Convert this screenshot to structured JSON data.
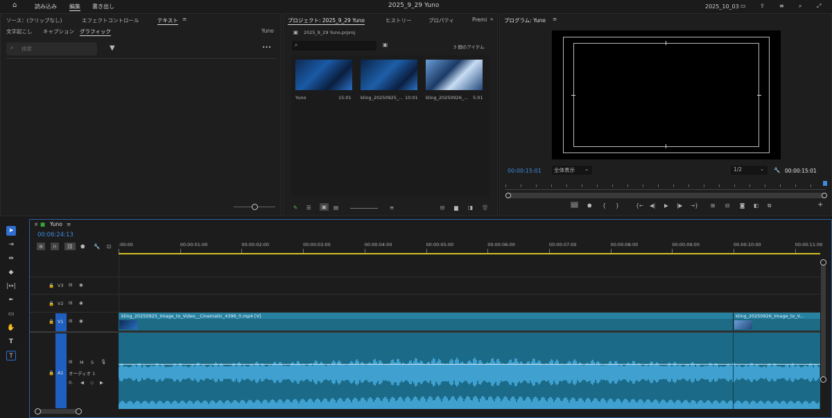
{
  "app": {
    "title": "2025_9_29 Yuno",
    "menu": [
      "読み込み",
      "編集",
      "書き出し"
    ],
    "active": "編集",
    "date": "2025_10_03"
  },
  "left": {
    "tabs": [
      "ソース：(クリップなし)",
      "エフェクトコントロール",
      "テキスト"
    ],
    "subtabs": [
      "文字起こし",
      "キャプション",
      "グラフィック"
    ],
    "sub_active": "グラフィック",
    "right_name": "Yuno",
    "search_placeholder": "検索"
  },
  "project": {
    "tabs": [
      "プロジェクト: 2025_9_29 Yuno",
      "ヒストリー",
      "プロパティ",
      "Premi"
    ],
    "file": "2025_9_29 Yuno.prproj",
    "count": "3 個のアイテム",
    "items": [
      {
        "name": "Yuno",
        "dur": "15:01"
      },
      {
        "name": "kling_20250925_...",
        "dur": "10:01"
      },
      {
        "name": "kling_20250926_...",
        "dur": "5:01"
      }
    ]
  },
  "program": {
    "title": "プログラム: Yuno",
    "timecode": "00:00:15:01",
    "fit": "全体表示",
    "res": "1/2",
    "duration": "00:00:15:01"
  },
  "timeline": {
    "seq": "Yuno",
    "timecode": "00:06:24:13",
    "ruler": [
      ":00:00",
      "00:00:01:00",
      "00:00:02:00",
      "00:00:03:00",
      "00:00:04:00",
      "00:00:05:00",
      "00:00:06:00",
      "00:00:07:00",
      "00:00:08:00",
      "00:00:09:00",
      "00:00:10:00",
      "00:00:11:00"
    ],
    "tracks": [
      "V3",
      "V2",
      "V1",
      "A1"
    ],
    "clip1": "kling_20250925_Image_to_Video__Cinematic_4396_0.mp4 [V]",
    "clip2": "kling_20250926_Image_to_V...",
    "audio_name": "オーディオ 1",
    "audio_val": "0.",
    "m": "M",
    "s": "S"
  },
  "colors": {
    "accent": "#3d8de0",
    "clip": "#1e6b86",
    "wave": "#4db3e8",
    "track_btn": "#1f5fbf"
  }
}
